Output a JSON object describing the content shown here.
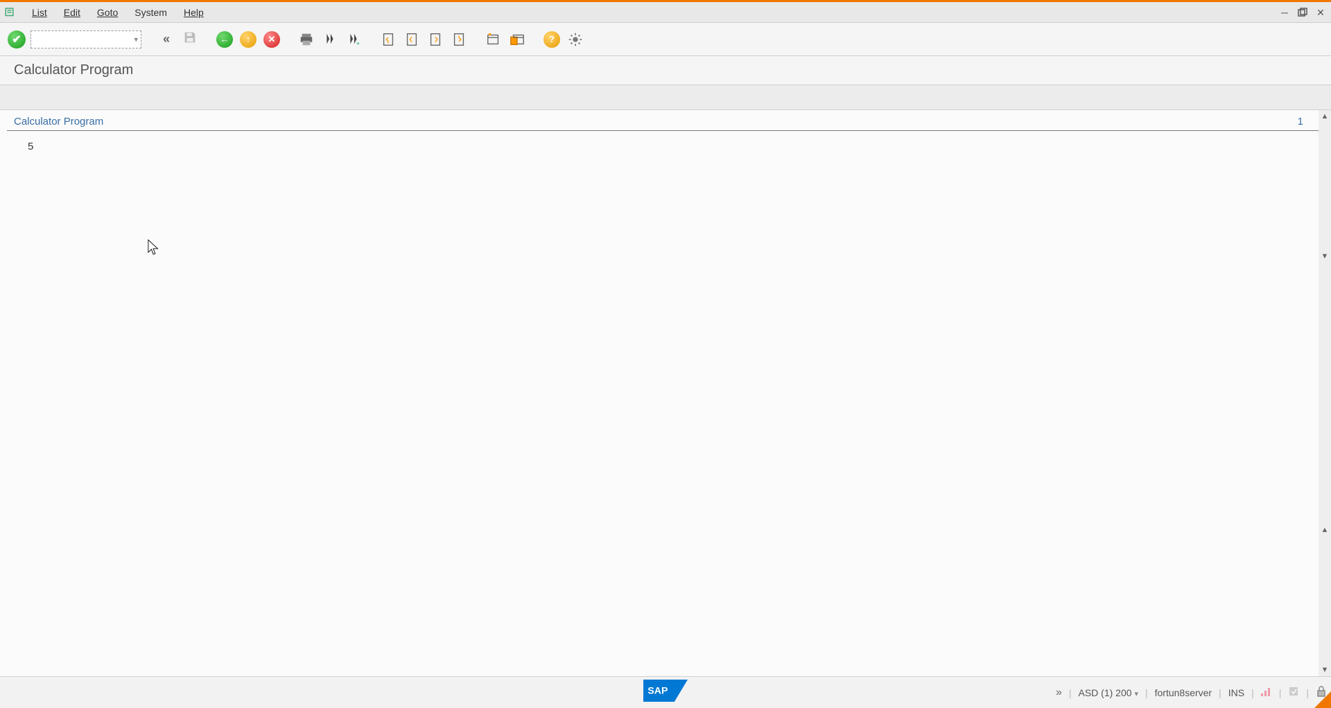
{
  "menubar": {
    "items": [
      "List",
      "Edit",
      "Goto",
      "System",
      "Help"
    ]
  },
  "toolbar": {
    "command_value": ""
  },
  "title": "Calculator Program",
  "list": {
    "header_left": "Calculator Program",
    "header_right": "1",
    "output": "5"
  },
  "statusbar": {
    "session": "ASD (1) 200",
    "server": "fortun8server",
    "mode": "INS"
  }
}
